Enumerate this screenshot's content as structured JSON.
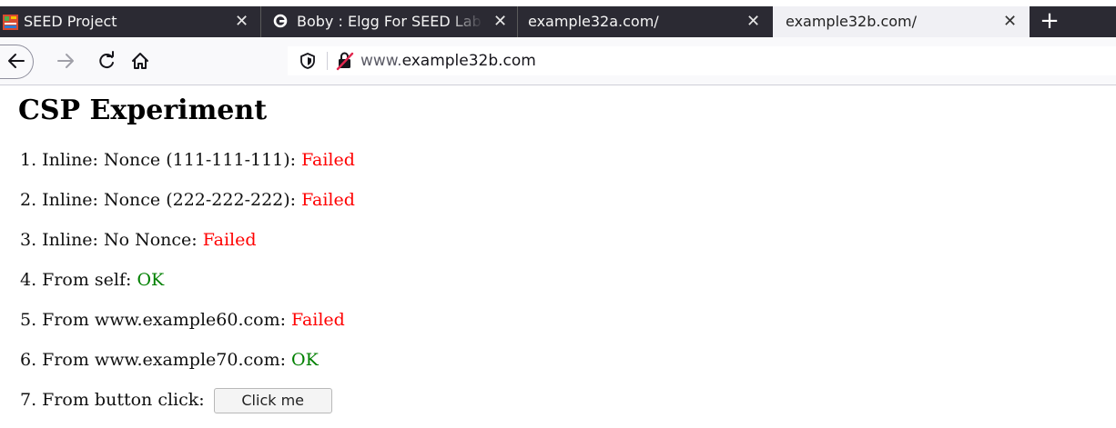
{
  "browser": {
    "tabs": [
      {
        "label": "SEED Project",
        "favicon": "seed-favicon",
        "active": false
      },
      {
        "label": "Boby : Elgg For SEED Lab",
        "favicon": "elgg-favicon",
        "active": false
      },
      {
        "label": "example32a.com/",
        "active": false
      },
      {
        "label": "example32b.com/",
        "active": true
      }
    ],
    "close_glyph": "✕",
    "new_tab_glyph": "+",
    "url": {
      "prefix": "www.",
      "host": "example32b.com"
    }
  },
  "page": {
    "title": "CSP Experiment",
    "results": [
      {
        "label": "1. Inline: Nonce (111-111-111): ",
        "status": "Failed"
      },
      {
        "label": "2. Inline: Nonce (222-222-222): ",
        "status": "Failed"
      },
      {
        "label": "3. Inline: No Nonce: ",
        "status": "Failed"
      },
      {
        "label": "4. From self: ",
        "status": "OK"
      },
      {
        "label": "5. From www.example60.com: ",
        "status": "Failed"
      },
      {
        "label": "6. From www.example70.com: ",
        "status": "OK"
      }
    ],
    "button_row": {
      "label": "7. From button click: ",
      "button_label": "Click me"
    }
  },
  "colors": {
    "failed": "#ff0000",
    "ok": "#008000",
    "tabbar": "#2b2a33"
  }
}
